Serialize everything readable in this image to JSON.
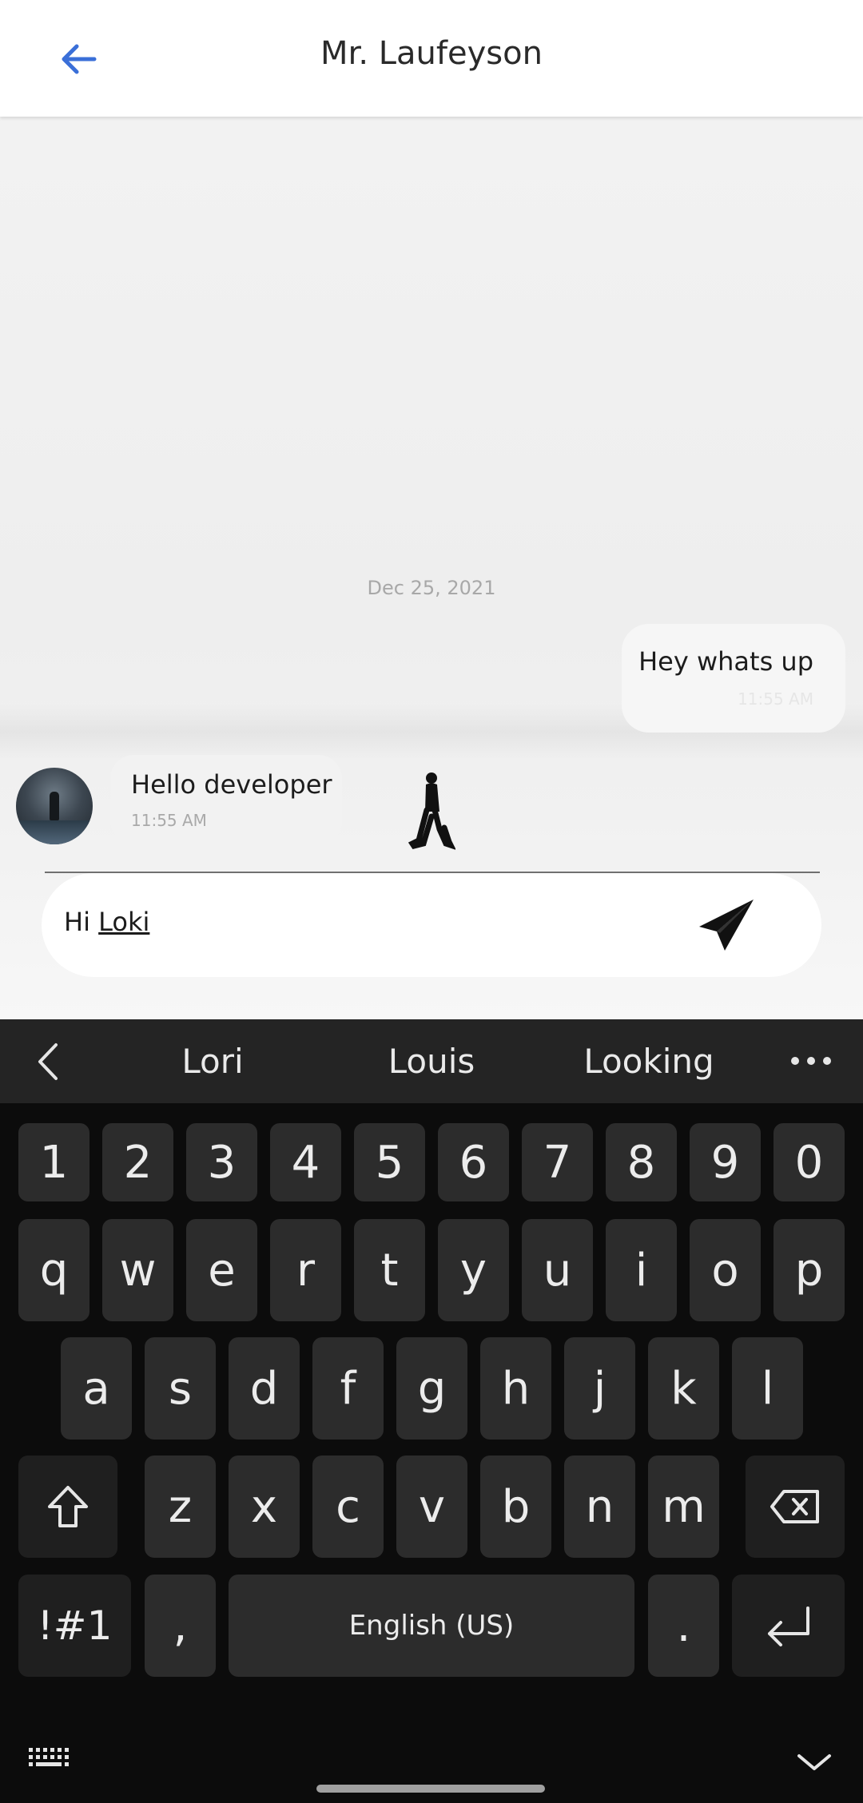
{
  "header": {
    "title": "Mr. Laufeyson",
    "back_icon": "back-arrow-icon",
    "accent": "#3a6fd8"
  },
  "chat": {
    "date_divider": "Dec 25, 2021",
    "messages": [
      {
        "direction": "outgoing",
        "text": "Hey whats up",
        "time": "11:55 AM"
      },
      {
        "direction": "incoming",
        "text": "Hello developer",
        "time": "11:55 AM"
      }
    ]
  },
  "composer": {
    "text_plain": "Hi ",
    "text_underlined": "Loki",
    "send_icon": "paper-plane-icon"
  },
  "keyboard": {
    "suggestions": [
      "Lori",
      "Louis",
      "Looking"
    ],
    "number_row": [
      "1",
      "2",
      "3",
      "4",
      "5",
      "6",
      "7",
      "8",
      "9",
      "0"
    ],
    "row_q": [
      "q",
      "w",
      "e",
      "r",
      "t",
      "y",
      "u",
      "i",
      "o",
      "p"
    ],
    "row_a": [
      "a",
      "s",
      "d",
      "f",
      "g",
      "h",
      "j",
      "k",
      "l"
    ],
    "row_z": [
      "z",
      "x",
      "c",
      "v",
      "b",
      "n",
      "m"
    ],
    "symbols_label": "!#1",
    "comma_label": ",",
    "space_label": "English (US)",
    "period_label": "."
  }
}
